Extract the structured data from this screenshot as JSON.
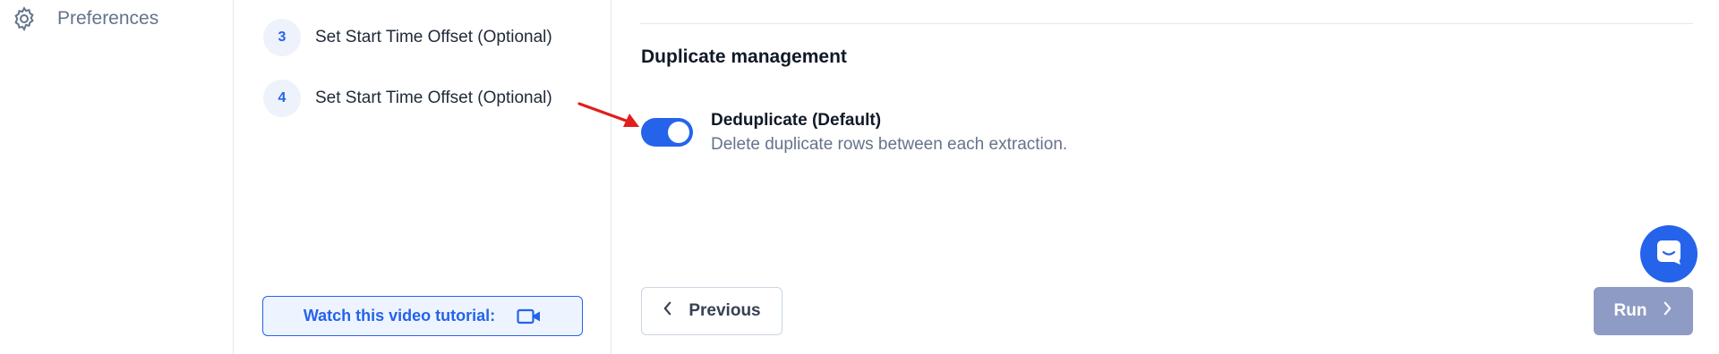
{
  "nav": {
    "preferences_label": "Preferences",
    "preferences_icon": "gear-icon"
  },
  "steps": [
    {
      "number": "3",
      "title": "Set Start Time Offset (Optional)"
    },
    {
      "number": "4",
      "title": "Set Start Time Offset (Optional)"
    }
  ],
  "tutorial": {
    "label": "Watch this video tutorial:",
    "icon": "video-camera-icon"
  },
  "duplicates": {
    "section_title": "Duplicate management",
    "toggle_on": true,
    "option_title": "Deduplicate (Default)",
    "option_description": "Delete duplicate rows between each extraction."
  },
  "footer": {
    "previous_label": "Previous",
    "run_label": "Run"
  },
  "colors": {
    "accent": "#2563eb",
    "run_disabled": "#8e9bc4",
    "annotation_arrow": "#e11d1d"
  }
}
